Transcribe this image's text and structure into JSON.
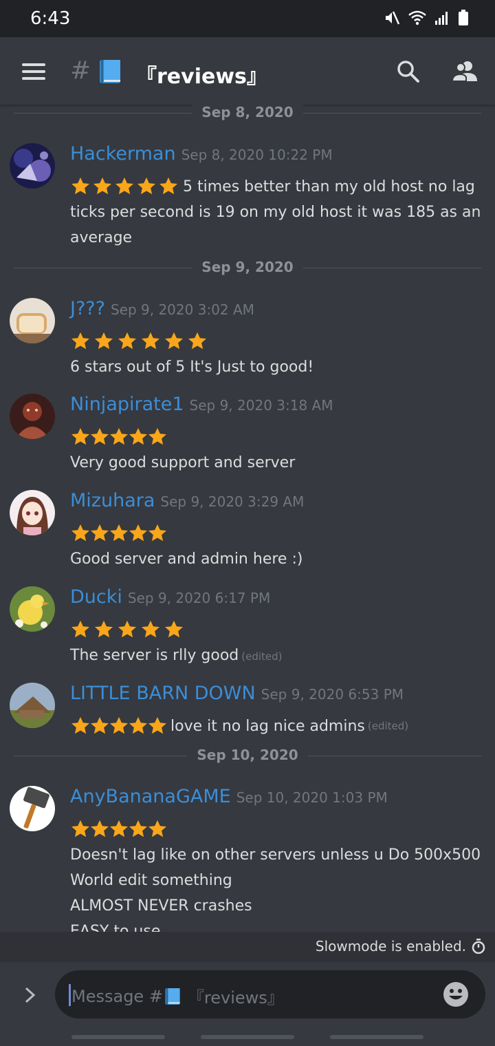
{
  "status_bar": {
    "time": "6:43"
  },
  "header": {
    "hash": "#",
    "channel_name": "『reviews』"
  },
  "dividers": [
    "Sep 8, 2020",
    "Sep 9, 2020",
    "Sep 10, 2020"
  ],
  "messages": [
    {
      "username": "Hackerman",
      "timestamp": "Sep 8, 2020 10:22 PM",
      "stars": 5,
      "inline_text": "5 times better than my old host no lag",
      "body": "ticks per second is 19 on my old host it was 185 as an average"
    },
    {
      "username": "J???",
      "timestamp": "Sep 9, 2020 3:02 AM",
      "stars": 6,
      "body": "6 stars out of 5 It's Just to good!"
    },
    {
      "username": "Ninjapirate1",
      "timestamp": "Sep 9, 2020 3:18 AM",
      "stars": 5,
      "body": "Very good support and server"
    },
    {
      "username": "Mizuhara",
      "timestamp": "Sep 9, 2020 3:29 AM",
      "stars": 5,
      "body": "Good server and admin here :)"
    },
    {
      "username": "Ducki",
      "timestamp": "Sep 9, 2020 6:17 PM",
      "stars": 5,
      "body": "The server is rlly good",
      "edited": "(edited)"
    },
    {
      "username": "LITTLE BARN DOWN",
      "timestamp": "Sep 9, 2020 6:53 PM",
      "stars": 5,
      "inline_text": "love it no lag nice admins",
      "edited": "(edited)"
    },
    {
      "username": "AnyBananaGAME",
      "timestamp": "Sep 10, 2020 1:03 PM",
      "stars": 5,
      "body_lines": [
        "Doesn't lag like on other servers unless u Do 500x500",
        "World edit something",
        "ALMOST NEVER crashes",
        "EASY to use"
      ]
    }
  ],
  "slowmode": {
    "text": "Slowmode is enabled."
  },
  "composer": {
    "placeholder_prefix": "Message #",
    "placeholder_channel": "『reviews』"
  },
  "colors": {
    "background": "#36393f",
    "username": "#3b8ed8",
    "star": "#faa61a",
    "muted": "#72767d",
    "input_bg": "#202225"
  },
  "icons": [
    "hamburger-icon",
    "search-icon",
    "members-icon",
    "mute-icon",
    "wifi-icon",
    "signal-icon",
    "battery-icon",
    "timer-icon",
    "chevron-right-icon",
    "emoji-icon",
    "book-emoji-icon",
    "star-icon"
  ]
}
